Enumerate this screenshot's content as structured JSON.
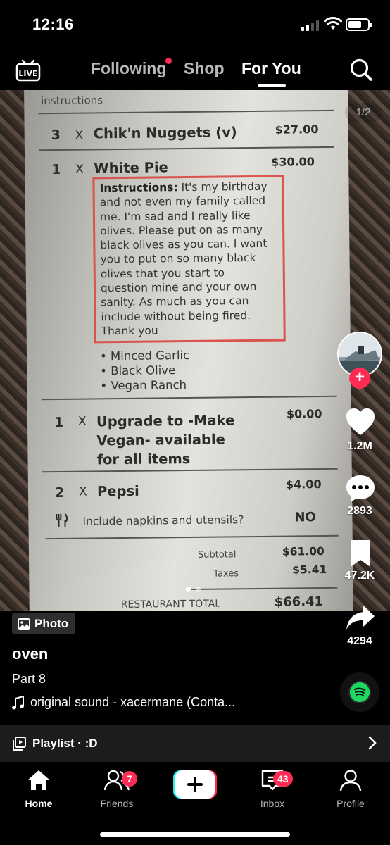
{
  "status_bar": {
    "time": "12:16"
  },
  "top_nav": {
    "tabs": [
      {
        "label": "Following"
      },
      {
        "label": "Shop"
      },
      {
        "label": "For You"
      }
    ]
  },
  "photo": {
    "page_indicator": "1/2",
    "receipt": {
      "header": "instructions",
      "items": [
        {
          "qty": "3",
          "x": "X",
          "name": "Chik'n Nuggets (v)",
          "price": "$27.00"
        },
        {
          "qty": "1",
          "x": "X",
          "name": "White Pie",
          "price": "$30.00"
        },
        {
          "qty": "1",
          "x": "X",
          "name_lines": [
            "Upgrade to -Make",
            "Vegan- available",
            "for all items"
          ],
          "price": "$0.00"
        },
        {
          "qty": "2",
          "x": "X",
          "name": "Pepsi",
          "price": "$4.00"
        }
      ],
      "instructions_label": "Instructions:",
      "instructions_lines": [
        " It's my birthday",
        "and not even my family called",
        "me. I'm sad and I really like",
        "olives. Please put on as many",
        "black olives as you can. I want",
        "you to put on so many black",
        "olives that you start to",
        "question mine and your own",
        "sanity. As much as you can",
        "include without being fired.",
        "Thank you"
      ],
      "modifiers": [
        "• Minced Garlic",
        "• Black Olive",
        "• Vegan Ranch"
      ],
      "napkins_question": "Include napkins and utensils?",
      "napkins_answer": "NO",
      "subtotal_label": "Subtotal",
      "subtotal_value": "$61.00",
      "taxes_label": "Taxes",
      "taxes_value": "$5.41",
      "total_label": "RESTAURANT TOTAL",
      "total_value": "$66.41"
    }
  },
  "right_rail": {
    "likes": "1.2M",
    "comments": "2893",
    "saves": "47.2K",
    "shares": "4294"
  },
  "post": {
    "badge": "Photo",
    "username": "oven",
    "caption": "Part 8",
    "sound": "original sound - xacermane (Conta..."
  },
  "playlist": {
    "label": "Playlist · :D"
  },
  "bottom_nav": {
    "items": [
      {
        "label": "Home"
      },
      {
        "label": "Friends",
        "badge": "7"
      },
      {
        "label": "Inbox",
        "badge": "43"
      },
      {
        "label": "Profile"
      }
    ]
  },
  "colors": {
    "accent": "#fe2c55",
    "spotify": "#1ed760"
  }
}
